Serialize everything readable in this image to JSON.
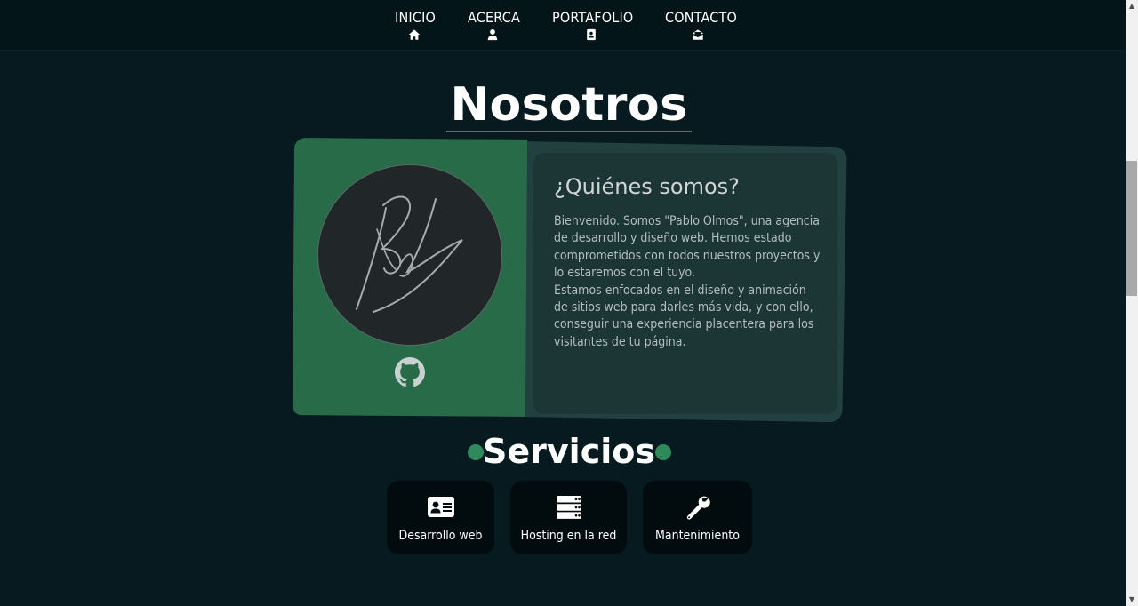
{
  "nav": {
    "items": [
      {
        "label": "INICIO",
        "icon": "home-icon"
      },
      {
        "label": "ACERCA",
        "icon": "user-icon"
      },
      {
        "label": "PORTAFOLIO",
        "icon": "portfolio-icon"
      },
      {
        "label": "CONTACTO",
        "icon": "envelope-icon"
      }
    ]
  },
  "about": {
    "title": "Nosotros",
    "card_title": "¿Quiénes somos?",
    "paragraph_1": "Bienvenido. Somos \"Pablo Olmos\", una agencia de desarrollo y diseño web. Hemos estado comprometidos con todos nuestros proyectos y lo estaremos con el tuyo.",
    "paragraph_2": "Estamos enfocados en el diseño y animación de sitios web para darles más vida, y con ello, conseguir una experiencia placentera para los visitantes de tu página.",
    "avatar_icon": "signature-logo",
    "social_icon": "github-icon"
  },
  "services": {
    "title": "Servicios",
    "items": [
      {
        "label": "Desarrollo web",
        "icon": "id-card-icon"
      },
      {
        "label": "Hosting en la red",
        "icon": "server-icon"
      },
      {
        "label": "Mantenimiento",
        "icon": "wrench-icon"
      }
    ]
  },
  "colors": {
    "background": "#071a1f",
    "nav_background": "#04151a",
    "accent_green": "#2e8a5a",
    "card_green": "#276b48",
    "card_panel": "#1c3535"
  }
}
